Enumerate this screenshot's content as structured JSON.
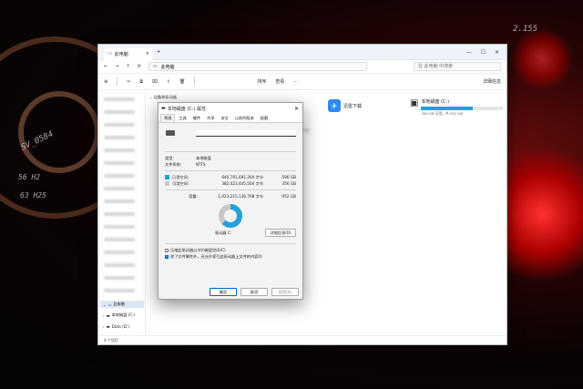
{
  "desktop": {
    "text1": "2.155",
    "text2": "SV_0584",
    "text3": "56 H2",
    "text4": "63 H25"
  },
  "explorer": {
    "tab_title": "此电脑",
    "breadcrumb": "此电脑",
    "search_placeholder": "在 此电脑 中搜索",
    "toolbar": {
      "sort": "排序",
      "view": "查看",
      "more": "···",
      "details": "详细信息"
    },
    "section_header": "设备和驱动器",
    "xunlei_label": "迅雷下载",
    "drive_c": {
      "label": "本地磁盘 (C:)",
      "free_text": "356 GB 可用，共 952 GB",
      "used_fraction": 0.626
    },
    "sidebar": {
      "item1": "此电脑",
      "item2": "本地磁盘 (C:)",
      "item3": "Data (D:)"
    },
    "status": "4 个项目"
  },
  "dialog": {
    "title": "本地磁盘 (C:) 属性",
    "tabs": [
      "常规",
      "工具",
      "硬件",
      "共享",
      "安全",
      "以前的版本",
      "配额"
    ],
    "type_label": "类型:",
    "type_value": "本地磁盘",
    "fs_label": "文件系统:",
    "fs_value": "NTFS",
    "used_label": "已用空间:",
    "used_bytes": "640,791,691,264 字节",
    "used_gb": "596 GB",
    "free_label": "可用空间:",
    "free_bytes": "382,423,445,504 字节",
    "free_gb": "356 GB",
    "cap_label": "容量:",
    "cap_bytes": "1,023,215,136,768 字节",
    "cap_gb": "952 GB",
    "drive_label": "驱动器 C:",
    "cleanup_btn": "详细信息(D)",
    "compress_label": "压缩此驱动器以节约磁盘空间(C)",
    "index_label": "除了文件属性外，还允许索引此驱动器上文件的内容(I)",
    "ok": "确定",
    "cancel": "取消",
    "apply": "应用(A)",
    "colors": {
      "used": "#26a0da",
      "free": "#c8c8c8"
    },
    "used_fraction": 0.626
  }
}
